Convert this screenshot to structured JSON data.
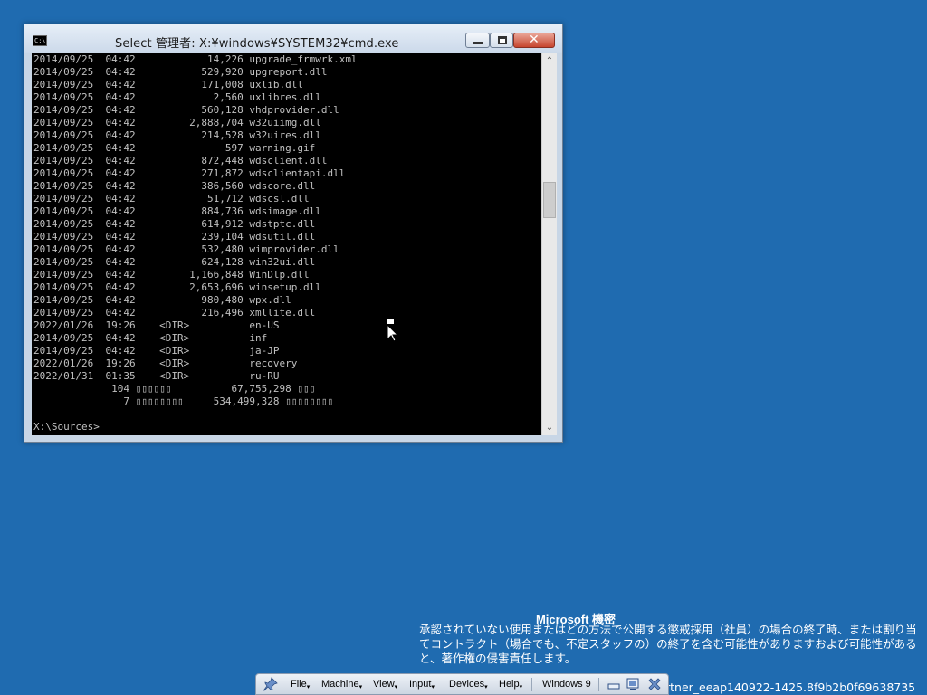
{
  "window": {
    "title": "Select 管理者: X:¥windows¥SYSTEM32¥cmd.exe",
    "icon_text": "C:\\",
    "buttons": [
      "minimize",
      "maximize",
      "close"
    ]
  },
  "console": {
    "lines": [
      "2014/09/25  04:42            14,226 upgrade_frmwrk.xml",
      "2014/09/25  04:42           529,920 upgreport.dll",
      "2014/09/25  04:42           171,008 uxlib.dll",
      "2014/09/25  04:42             2,560 uxlibres.dll",
      "2014/09/25  04:42           560,128 vhdprovider.dll",
      "2014/09/25  04:42         2,888,704 w32uiimg.dll",
      "2014/09/25  04:42           214,528 w32uires.dll",
      "2014/09/25  04:42               597 warning.gif",
      "2014/09/25  04:42           872,448 wdsclient.dll",
      "2014/09/25  04:42           271,872 wdsclientapi.dll",
      "2014/09/25  04:42           386,560 wdscore.dll",
      "2014/09/25  04:42            51,712 wdscsl.dll",
      "2014/09/25  04:42           884,736 wdsimage.dll",
      "2014/09/25  04:42           614,912 wdstptc.dll",
      "2014/09/25  04:42           239,104 wdsutil.dll",
      "2014/09/25  04:42           532,480 wimprovider.dll",
      "2014/09/25  04:42           624,128 win32ui.dll",
      "2014/09/25  04:42         1,166,848 WinDlp.dll",
      "2014/09/25  04:42         2,653,696 winsetup.dll",
      "2014/09/25  04:42           980,480 wpx.dll",
      "2014/09/25  04:42           216,496 xmllite.dll",
      "2022/01/26  19:26    <DIR>          en-US",
      "2014/09/25  04:42    <DIR>          inf",
      "2014/09/25  04:42    <DIR>          ja-JP",
      "2022/01/26  19:26    <DIR>          recovery",
      "2022/01/31  01:35    <DIR>          ru-RU",
      "             104 ▯▯▯▯▯▯          67,755,298 ▯▯▯",
      "               7 ▯▯▯▯▯▯▯▯     534,499,328 ▯▯▯▯▯▯▯▯",
      "",
      "X:\\Sources>"
    ]
  },
  "notice": {
    "title": "Microsoft  機密",
    "body": "承認されていない使用またはどの方法で公開する懲戒採用（社員）の場合の終了時、または割り当てコントラクト（場合でも、不定スタッフの）の終了を含む可能性がありますおよび可能性があると、著作権の侵害責任します。"
  },
  "build_id": "rtner_eeap140922-1425.8f9b2b0f69638735",
  "vm_toolbar": {
    "menus": [
      "File",
      "Machine",
      "View",
      "Input",
      "Devices",
      "Help"
    ],
    "vm_name": "Windows 9"
  },
  "colors": {
    "desktop": "#1f6bb0",
    "console_bg": "#000000",
    "console_fg": "#c0c0c0"
  }
}
